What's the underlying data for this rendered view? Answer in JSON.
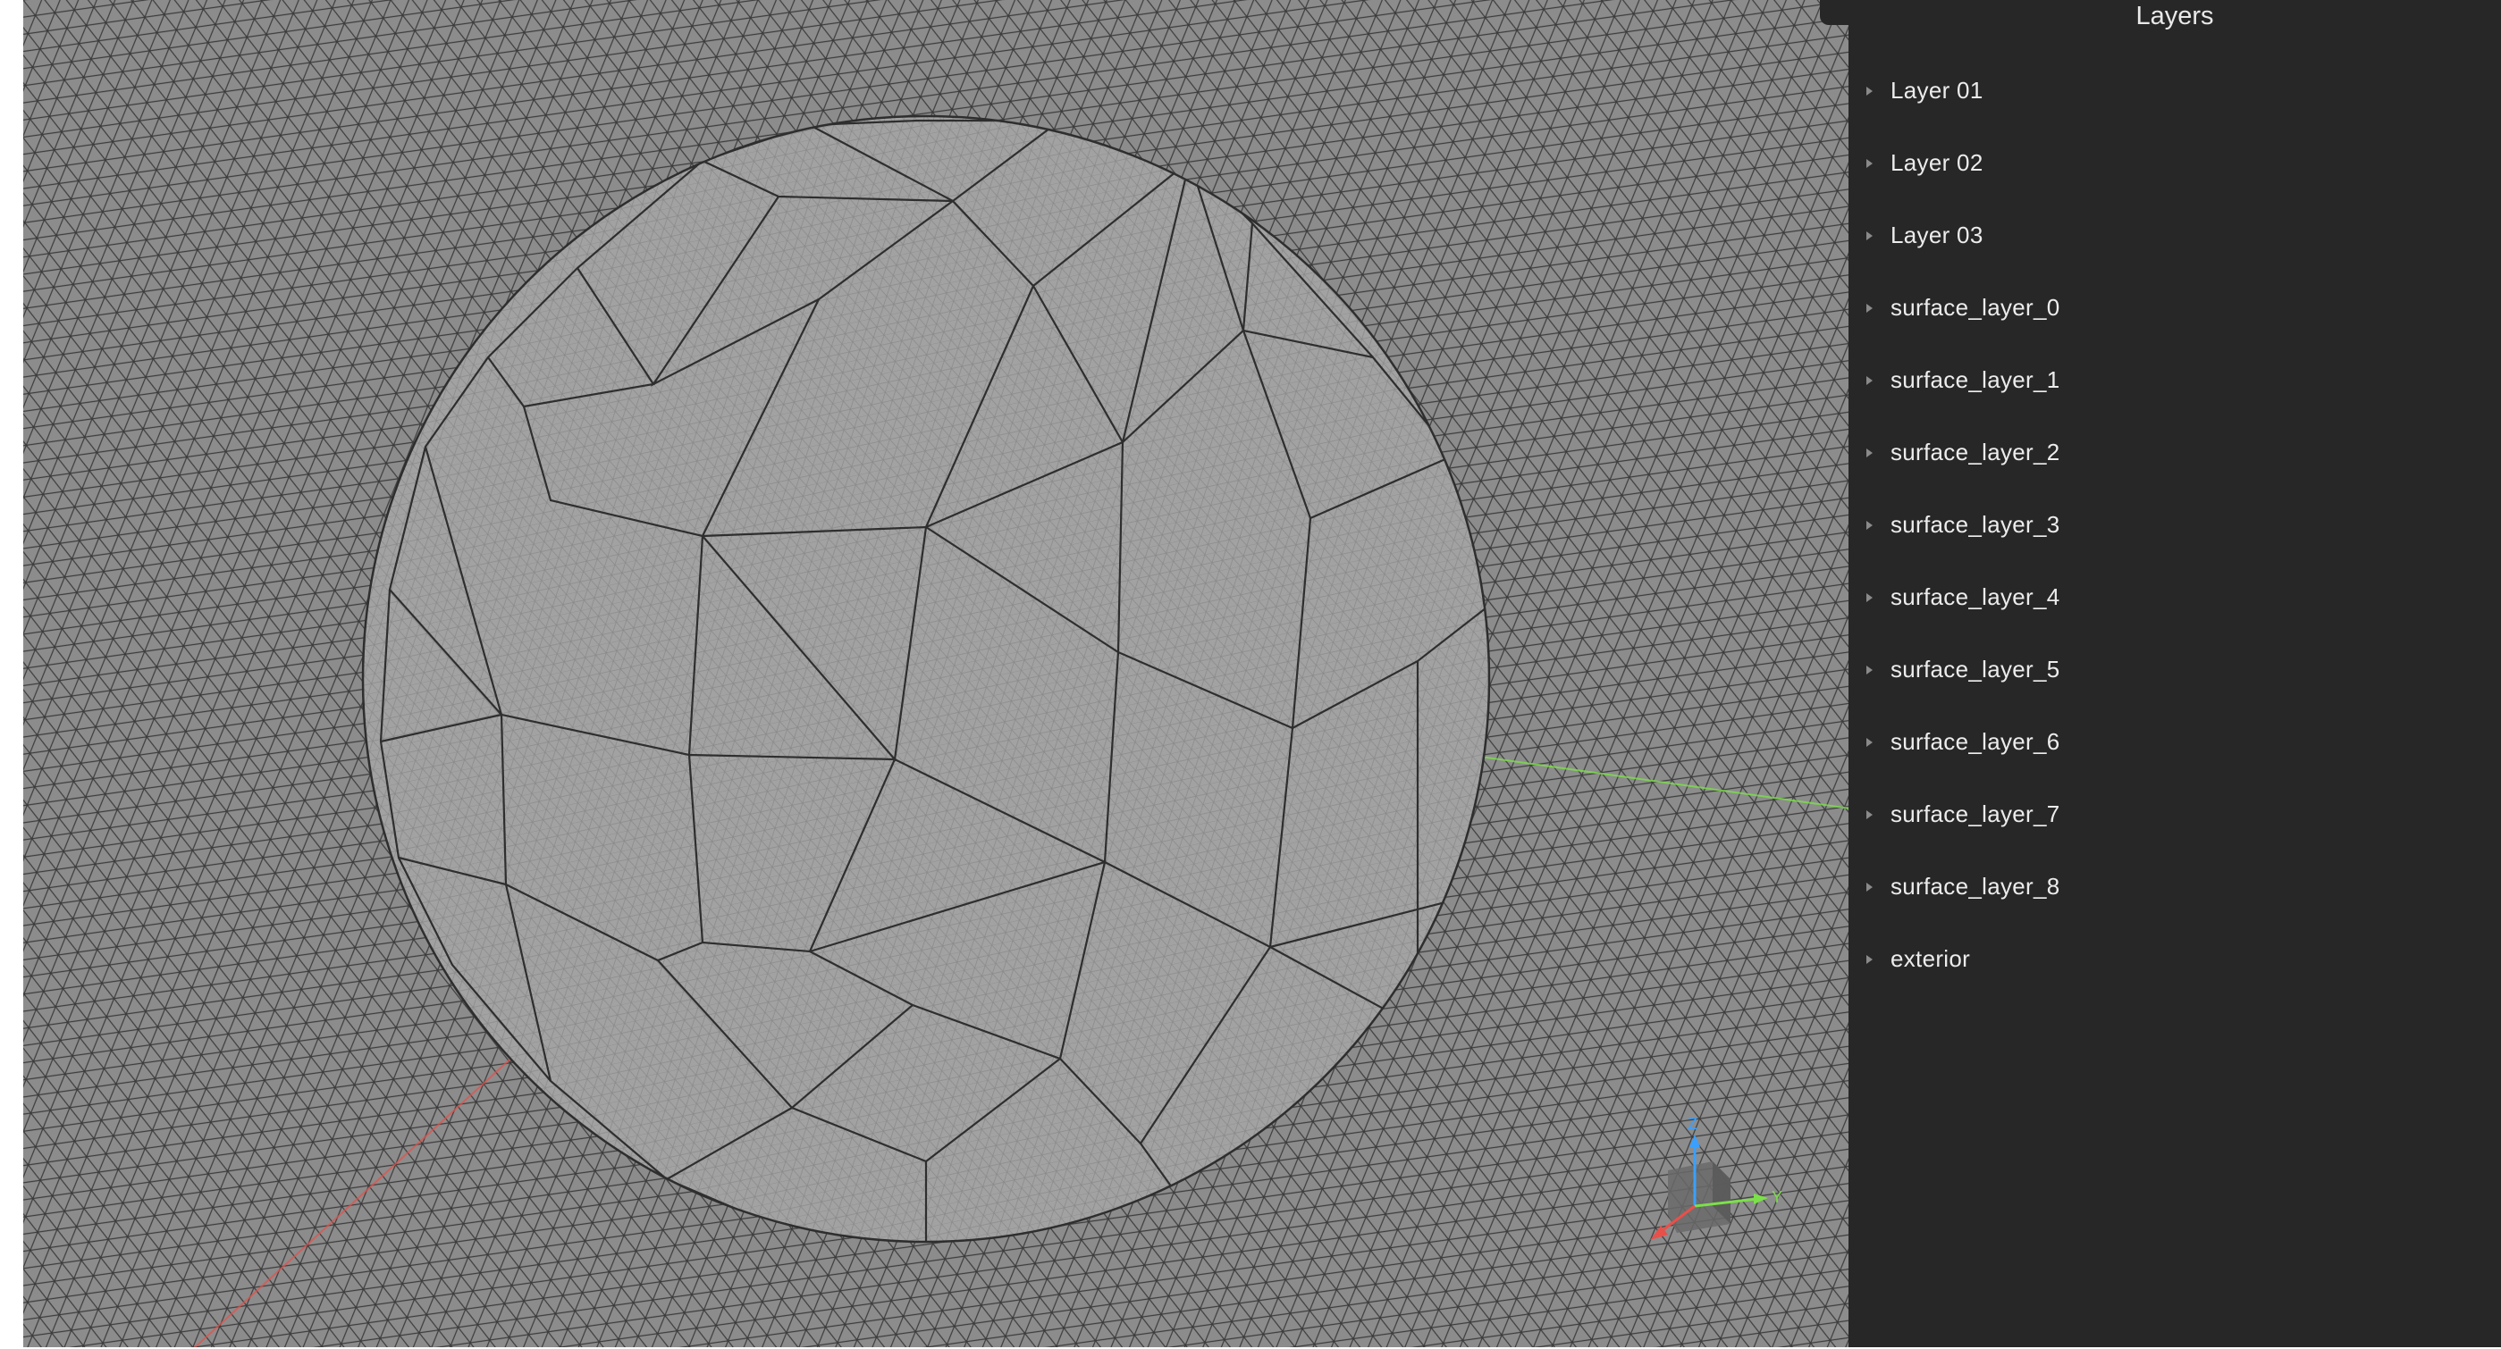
{
  "viewport": {
    "background": "#8c8c8c",
    "mesh_color": "#3a3a3a",
    "sphere_color": "#9e9e9e",
    "axis_x_color": "#e8504a",
    "axis_y_color": "#7ce04a",
    "axis_z_color": "#3aa0ff",
    "gizmo_labels": {
      "z": "Z",
      "y": "Y"
    }
  },
  "panel": {
    "title": "Layers",
    "layers": [
      {
        "label": "Layer 01"
      },
      {
        "label": "Layer 02"
      },
      {
        "label": "Layer 03"
      },
      {
        "label": "surface_layer_0"
      },
      {
        "label": "surface_layer_1"
      },
      {
        "label": "surface_layer_2"
      },
      {
        "label": "surface_layer_3"
      },
      {
        "label": "surface_layer_4"
      },
      {
        "label": "surface_layer_5"
      },
      {
        "label": "surface_layer_6"
      },
      {
        "label": "surface_layer_7"
      },
      {
        "label": "surface_layer_8"
      },
      {
        "label": "exterior"
      }
    ]
  }
}
